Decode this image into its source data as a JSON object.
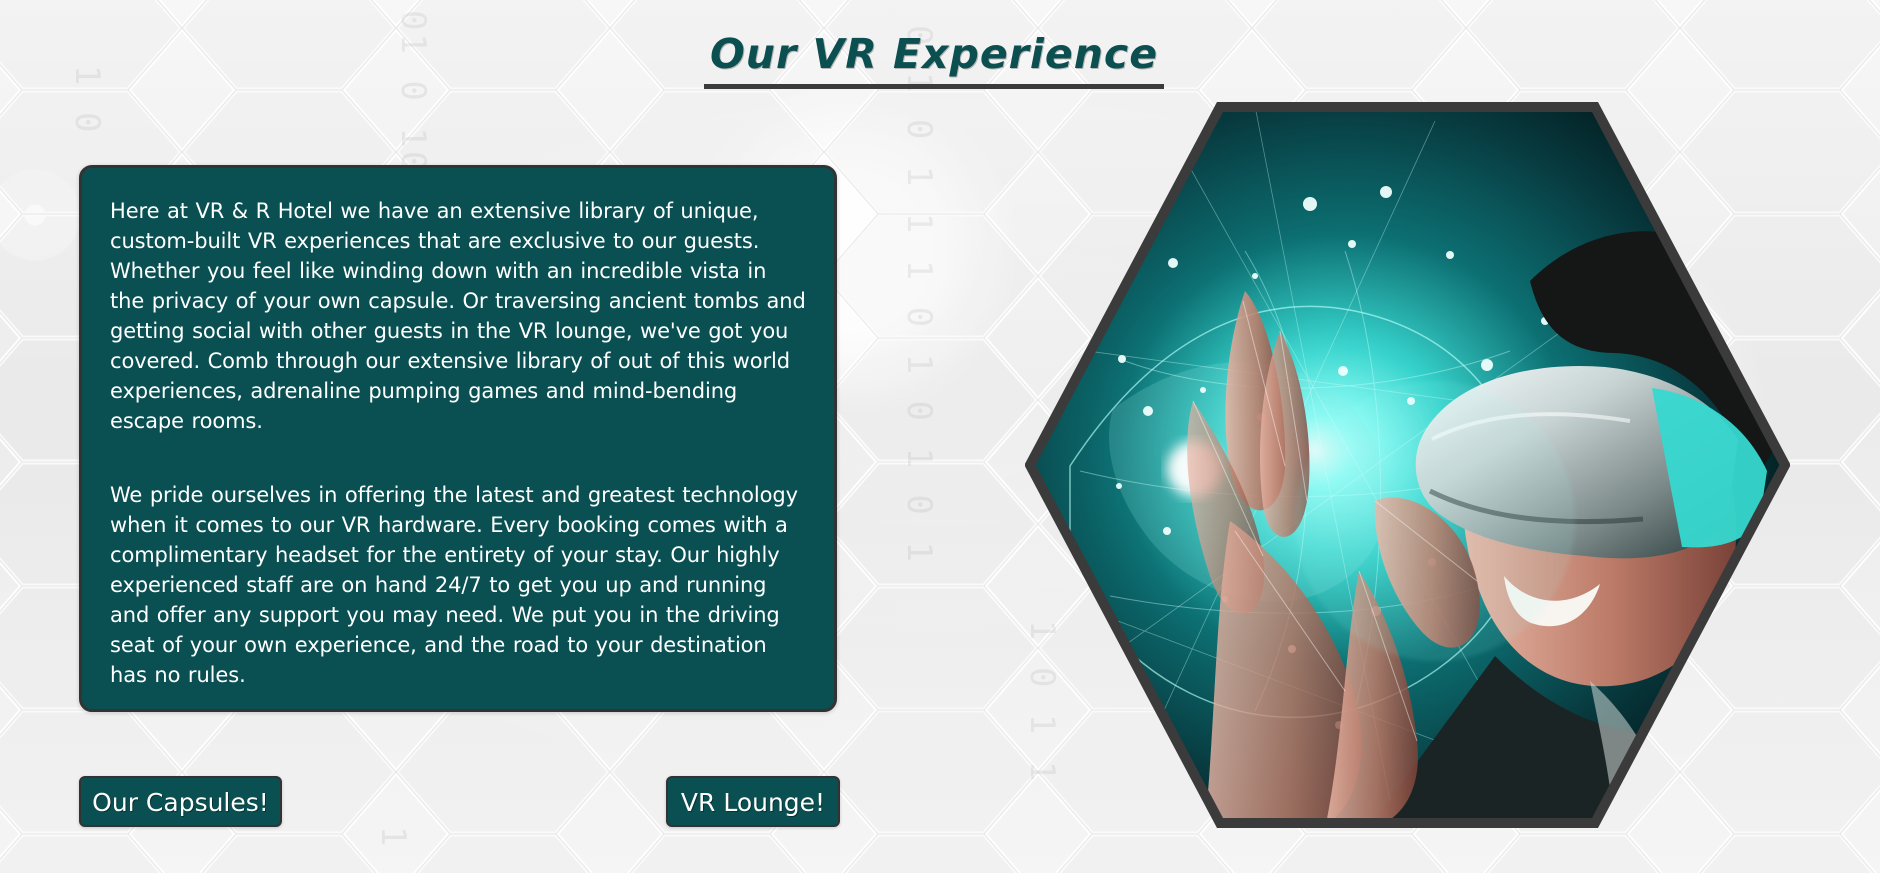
{
  "page": {
    "title": "Our VR Experience",
    "paragraphs": [
      "Here at VR & R Hotel we have an extensive library of unique, custom-built VR experiences that are exclusive to our guests. Whether you feel like winding down with an incredible vista in the privacy of your own capsule. Or traversing ancient tombs and getting social with other guests in the VR lounge, we've got you covered. Comb through our extensive library of out of this world experiences, adrenaline pumping games and mind-bending escape rooms.",
      "We pride ourselves in offering the latest and greatest technology when it comes to our VR hardware. Every booking comes with a complimentary headset for the entirety of your stay. Our highly experienced staff are on hand 24/7 to get you up and running and offer any support you may need. We put you in the driving seat of your own experience, and the road to your destination has no rules."
    ],
    "buttons": {
      "capsules": "Our Capsules!",
      "lounge": "VR Lounge!"
    }
  },
  "colors": {
    "accent": "#0a5052",
    "title": "#0b4f50",
    "border": "#333333",
    "background": "#f2f2f2",
    "image_accent": "#36d5cf"
  },
  "icons": {
    "hero": "vr-headset-globe-image"
  }
}
